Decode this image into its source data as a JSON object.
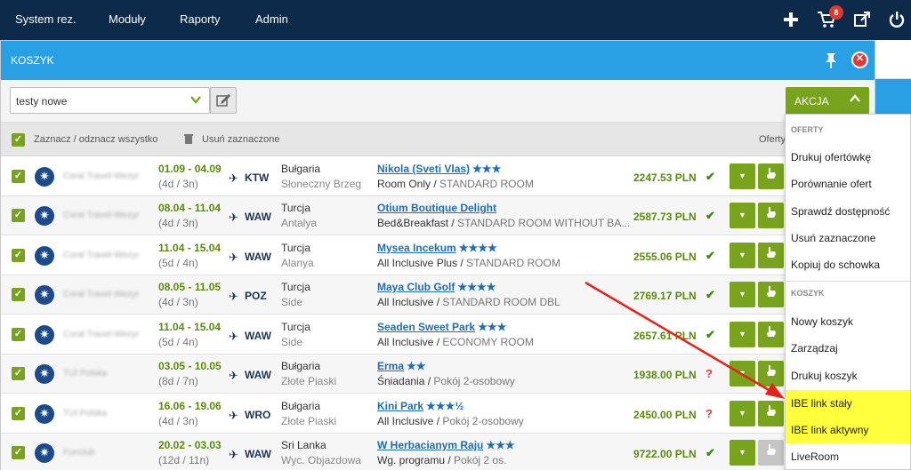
{
  "nav": {
    "items": [
      "System rez.",
      "Moduły",
      "Raporty",
      "Admin"
    ],
    "cart_count": "8"
  },
  "panel": {
    "title": "KOSZYK",
    "select_value": "testy nowe",
    "action_label": "AKCJA",
    "select_all_label": "Zaznacz / odznacz wszystko",
    "delete_selected_label": "Usuń zaznaczone",
    "offers_label": "Oferty"
  },
  "rows": [
    {
      "agent": "Coral Travel-Wezyr",
      "dates": "01.09 - 04.09",
      "duration": "(4d / 3n)",
      "airport": "KTW",
      "country": "Bułgaria",
      "region": "Słoneczny Brzeg",
      "hotel": "Nikola (Sveti Vlas)",
      "stars": "★★★",
      "board": "Room Only",
      "room": "STANDARD ROOM",
      "price": "2247.53 PLN",
      "status": "✔",
      "status_color": "#3c8a0e"
    },
    {
      "agent": "Coral Travel-Wezyr",
      "dates": "08.04 - 11.04",
      "duration": "(4d / 3n)",
      "airport": "WAW",
      "country": "Turcja",
      "region": "Antalya",
      "hotel": "Otium Boutique Delight",
      "stars": "",
      "board": "Bed&Breakfast",
      "room": "STANDARD ROOM WITHOUT BA...",
      "price": "2587.73 PLN",
      "status": "✔",
      "status_color": "#3c8a0e"
    },
    {
      "agent": "Coral Travel-Wezyr",
      "dates": "11.04 - 15.04",
      "duration": "(5d / 4n)",
      "airport": "WAW",
      "country": "Turcja",
      "region": "Alanya",
      "hotel": "Mysea Incekum",
      "stars": "★★★★",
      "board": "All Inclusive Plus",
      "room": "STANDARD ROOM",
      "price": "2555.06 PLN",
      "status": "✔",
      "status_color": "#3c8a0e"
    },
    {
      "agent": "Coral Travel-Wezyr",
      "dates": "08.05 - 11.05",
      "duration": "(4d / 3n)",
      "airport": "POZ",
      "country": "Turcja",
      "region": "Side",
      "hotel": "Maya Club Golf",
      "stars": "★★★★",
      "board": "All Inclusive",
      "room": "STANDARD ROOM DBL",
      "price": "2769.17 PLN",
      "status": "✔",
      "status_color": "#3c8a0e"
    },
    {
      "agent": "Coral Travel-Wezyr",
      "dates": "11.04 - 15.04",
      "duration": "(5d / 4n)",
      "airport": "WAW",
      "country": "Turcja",
      "region": "Side",
      "hotel": "Seaden Sweet Park",
      "stars": "★★★",
      "board": "All Inclusive",
      "room": "ECONOMY ROOM",
      "price": "2657.61 PLN",
      "status": "✔",
      "status_color": "#3c8a0e"
    },
    {
      "agent": "TUI Polska",
      "dates": "03.05 - 10.05",
      "duration": "(8d / 7n)",
      "airport": "WAW",
      "country": "Bułgaria",
      "region": "Złote Piaski",
      "hotel": "Erma",
      "stars": "★★",
      "board": "Śniadania",
      "room": "Pokój 2-osobowy",
      "price": "1938.00 PLN",
      "status": "?",
      "status_color": "#e23b2a"
    },
    {
      "agent": "TUI Polska",
      "dates": "16.06 - 19.06",
      "duration": "(4d / 3n)",
      "airport": "WRO",
      "country": "Bułgaria",
      "region": "Złote Piaski",
      "hotel": "Kini Park",
      "stars": "★★★½",
      "board": "All Inclusive",
      "room": "Pokój 2-osobowy",
      "price": "2450.00 PLN",
      "status": "?",
      "status_color": "#e23b2a"
    },
    {
      "agent": "Funclub",
      "dates": "20.02 - 03.03",
      "duration": "(12d / 11n)",
      "airport": "WAW",
      "country": "Sri Lanka",
      "region": "Wyc. Objazdowa",
      "hotel": "W Herbacianym Raju",
      "stars": "★★★",
      "board": "Wg. programu",
      "room": "Pokój 2 os.",
      "price": "9722.00 PLN",
      "status": "✔",
      "status_color": "#3c8a0e"
    }
  ],
  "dropdown": {
    "section_offers": "OFERTY",
    "offers_items": [
      "Drukuj ofertówkę",
      "Porównanie ofert",
      "Sprawdź dostępność",
      "Usuń zaznaczone",
      "Kopiuj do schowka"
    ],
    "section_cart": "KOSZYK",
    "cart_items": [
      "Nowy koszyk",
      "Zarządzaj",
      "Drukuj koszyk",
      "IBE link stały",
      "IBE link aktywny",
      "LiveRoom"
    ]
  },
  "colors": {
    "nav_bg": "#0d2a4a",
    "panel_header": "#2aa0e4",
    "accent_green": "#77a31d",
    "highlight": "#ffff3c",
    "arrow": "#e8201a"
  }
}
